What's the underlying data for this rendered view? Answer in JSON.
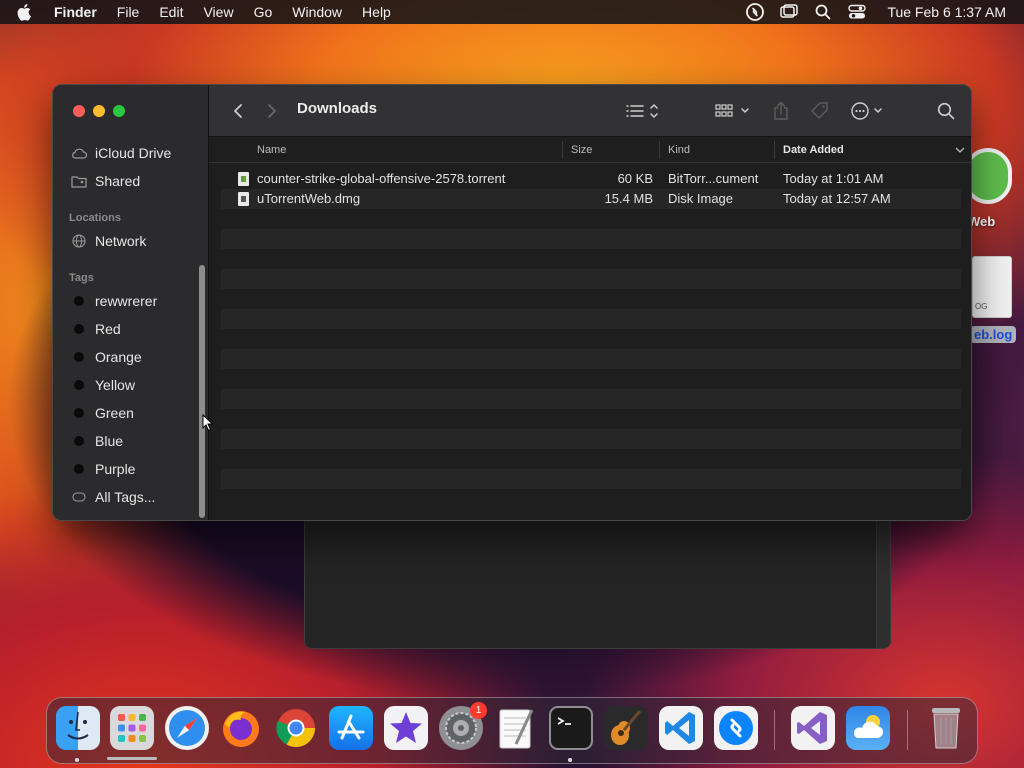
{
  "menubar": {
    "app": "Finder",
    "menus": [
      "File",
      "Edit",
      "View",
      "Go",
      "Window",
      "Help"
    ],
    "clock": "Tue Feb 6  1:37 AM"
  },
  "desktop": {
    "web_label": "Web",
    "log_label": "eb.log",
    "log_doc_text": "OG"
  },
  "sidebar": {
    "favorites": [
      {
        "label": "iCloud Drive",
        "icon": "cloud-icon"
      },
      {
        "label": "Shared",
        "icon": "shared-folder-icon"
      }
    ],
    "locations_header": "Locations",
    "locations": [
      {
        "label": "Network",
        "icon": "globe-icon"
      }
    ],
    "tags_header": "Tags",
    "tags": [
      "rewwrerer",
      "Red",
      "Orange",
      "Yellow",
      "Green",
      "Blue",
      "Purple"
    ],
    "all_tags": "All Tags..."
  },
  "toolbar": {
    "title": "Downloads"
  },
  "columns": {
    "name": "Name",
    "size": "Size",
    "kind": "Kind",
    "date_added": "Date Added"
  },
  "files": [
    {
      "name": "counter-strike-global-offensive-2578.torrent",
      "size": "60 KB",
      "kind": "BitTorr...cument",
      "date_added": "Today at 1:01 AM",
      "icon": "torrent-file-icon"
    },
    {
      "name": "uTorrentWeb.dmg",
      "size": "15.4 MB",
      "kind": "Disk Image",
      "date_added": "Today at 12:57 AM",
      "icon": "disk-image-icon"
    }
  ],
  "dock": {
    "apps": [
      "Finder",
      "Launchpad",
      "Safari",
      "Firefox",
      "Google Chrome",
      "App Store",
      "iMovie",
      "System Preferences",
      "TextEdit",
      "Terminal",
      "GarageBand",
      "Visual Studio Code",
      "Shazam",
      "Visual Studio",
      "Weather",
      "Trash"
    ],
    "badge": "1"
  },
  "colors": {
    "close": "#ff5f57",
    "minimize": "#febc2e",
    "zoom": "#28c840"
  }
}
